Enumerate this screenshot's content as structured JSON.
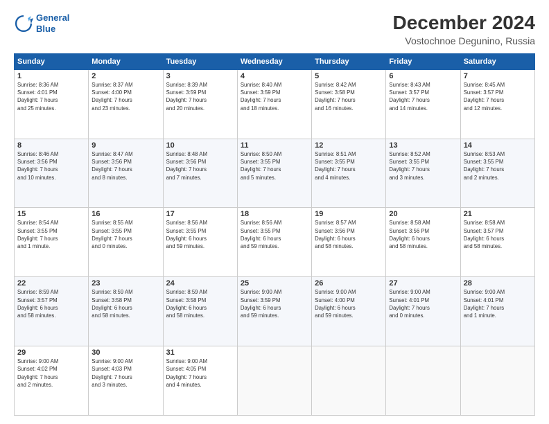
{
  "logo": {
    "line1": "General",
    "line2": "Blue"
  },
  "title": "December 2024",
  "subtitle": "Vostochnoe Degunino, Russia",
  "days_header": [
    "Sunday",
    "Monday",
    "Tuesday",
    "Wednesday",
    "Thursday",
    "Friday",
    "Saturday"
  ],
  "weeks": [
    [
      {
        "day": "1",
        "info": "Sunrise: 8:36 AM\nSunset: 4:01 PM\nDaylight: 7 hours\nand 25 minutes."
      },
      {
        "day": "2",
        "info": "Sunrise: 8:37 AM\nSunset: 4:00 PM\nDaylight: 7 hours\nand 23 minutes."
      },
      {
        "day": "3",
        "info": "Sunrise: 8:39 AM\nSunset: 3:59 PM\nDaylight: 7 hours\nand 20 minutes."
      },
      {
        "day": "4",
        "info": "Sunrise: 8:40 AM\nSunset: 3:59 PM\nDaylight: 7 hours\nand 18 minutes."
      },
      {
        "day": "5",
        "info": "Sunrise: 8:42 AM\nSunset: 3:58 PM\nDaylight: 7 hours\nand 16 minutes."
      },
      {
        "day": "6",
        "info": "Sunrise: 8:43 AM\nSunset: 3:57 PM\nDaylight: 7 hours\nand 14 minutes."
      },
      {
        "day": "7",
        "info": "Sunrise: 8:45 AM\nSunset: 3:57 PM\nDaylight: 7 hours\nand 12 minutes."
      }
    ],
    [
      {
        "day": "8",
        "info": "Sunrise: 8:46 AM\nSunset: 3:56 PM\nDaylight: 7 hours\nand 10 minutes."
      },
      {
        "day": "9",
        "info": "Sunrise: 8:47 AM\nSunset: 3:56 PM\nDaylight: 7 hours\nand 8 minutes."
      },
      {
        "day": "10",
        "info": "Sunrise: 8:48 AM\nSunset: 3:56 PM\nDaylight: 7 hours\nand 7 minutes."
      },
      {
        "day": "11",
        "info": "Sunrise: 8:50 AM\nSunset: 3:55 PM\nDaylight: 7 hours\nand 5 minutes."
      },
      {
        "day": "12",
        "info": "Sunrise: 8:51 AM\nSunset: 3:55 PM\nDaylight: 7 hours\nand 4 minutes."
      },
      {
        "day": "13",
        "info": "Sunrise: 8:52 AM\nSunset: 3:55 PM\nDaylight: 7 hours\nand 3 minutes."
      },
      {
        "day": "14",
        "info": "Sunrise: 8:53 AM\nSunset: 3:55 PM\nDaylight: 7 hours\nand 2 minutes."
      }
    ],
    [
      {
        "day": "15",
        "info": "Sunrise: 8:54 AM\nSunset: 3:55 PM\nDaylight: 7 hours\nand 1 minute."
      },
      {
        "day": "16",
        "info": "Sunrise: 8:55 AM\nSunset: 3:55 PM\nDaylight: 7 hours\nand 0 minutes."
      },
      {
        "day": "17",
        "info": "Sunrise: 8:56 AM\nSunset: 3:55 PM\nDaylight: 6 hours\nand 59 minutes."
      },
      {
        "day": "18",
        "info": "Sunrise: 8:56 AM\nSunset: 3:55 PM\nDaylight: 6 hours\nand 59 minutes."
      },
      {
        "day": "19",
        "info": "Sunrise: 8:57 AM\nSunset: 3:56 PM\nDaylight: 6 hours\nand 58 minutes."
      },
      {
        "day": "20",
        "info": "Sunrise: 8:58 AM\nSunset: 3:56 PM\nDaylight: 6 hours\nand 58 minutes."
      },
      {
        "day": "21",
        "info": "Sunrise: 8:58 AM\nSunset: 3:57 PM\nDaylight: 6 hours\nand 58 minutes."
      }
    ],
    [
      {
        "day": "22",
        "info": "Sunrise: 8:59 AM\nSunset: 3:57 PM\nDaylight: 6 hours\nand 58 minutes."
      },
      {
        "day": "23",
        "info": "Sunrise: 8:59 AM\nSunset: 3:58 PM\nDaylight: 6 hours\nand 58 minutes."
      },
      {
        "day": "24",
        "info": "Sunrise: 8:59 AM\nSunset: 3:58 PM\nDaylight: 6 hours\nand 58 minutes."
      },
      {
        "day": "25",
        "info": "Sunrise: 9:00 AM\nSunset: 3:59 PM\nDaylight: 6 hours\nand 59 minutes."
      },
      {
        "day": "26",
        "info": "Sunrise: 9:00 AM\nSunset: 4:00 PM\nDaylight: 6 hours\nand 59 minutes."
      },
      {
        "day": "27",
        "info": "Sunrise: 9:00 AM\nSunset: 4:01 PM\nDaylight: 7 hours\nand 0 minutes."
      },
      {
        "day": "28",
        "info": "Sunrise: 9:00 AM\nSunset: 4:01 PM\nDaylight: 7 hours\nand 1 minute."
      }
    ],
    [
      {
        "day": "29",
        "info": "Sunrise: 9:00 AM\nSunset: 4:02 PM\nDaylight: 7 hours\nand 2 minutes."
      },
      {
        "day": "30",
        "info": "Sunrise: 9:00 AM\nSunset: 4:03 PM\nDaylight: 7 hours\nand 3 minutes."
      },
      {
        "day": "31",
        "info": "Sunrise: 9:00 AM\nSunset: 4:05 PM\nDaylight: 7 hours\nand 4 minutes."
      },
      null,
      null,
      null,
      null
    ]
  ]
}
